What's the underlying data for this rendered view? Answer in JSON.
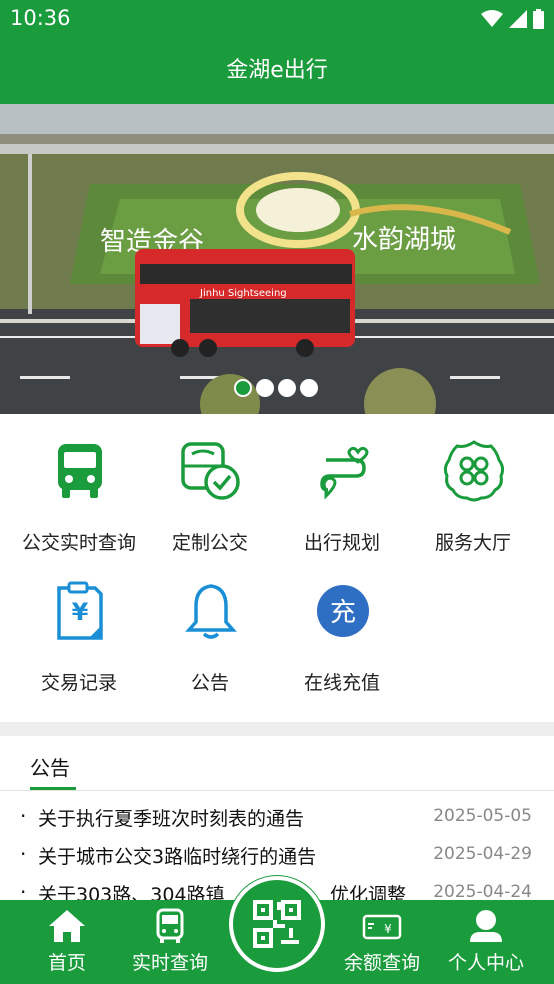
{
  "status_bar": {
    "time": "10:36"
  },
  "app_bar": {
    "title": "金湖e出行"
  },
  "banner": {
    "dots": 4,
    "active_dot": 0,
    "sign_text_left": "智造金谷",
    "sign_text_right": "水韵湖城",
    "bus_text": "Jinhu Sightseeing"
  },
  "services": [
    {
      "label": "公交实时查询",
      "icon": "bus-icon"
    },
    {
      "label": "定制公交",
      "icon": "custom-bus-icon"
    },
    {
      "label": "出行规划",
      "icon": "route-plan-icon"
    },
    {
      "label": "服务大厅",
      "icon": "service-hall-icon"
    },
    {
      "label": "交易记录",
      "icon": "transaction-record-icon"
    },
    {
      "label": "公告",
      "icon": "bell-icon"
    },
    {
      "label": "在线充值",
      "icon": "recharge-icon",
      "glyph": "充"
    }
  ],
  "notices": {
    "tab_label": "公告",
    "items": [
      {
        "title": "关于执行夏季班次时刻表的通告",
        "date": "2025-05-05"
      },
      {
        "title": "关于城市公交3路临时绕行的通告",
        "date": "2025-04-29"
      },
      {
        "title": "关于303路、304路镇",
        "date": "2025-04-24"
      }
    ],
    "partial_suffix": "优化调整"
  },
  "bottom_nav": {
    "home": "首页",
    "realtime": "实时查询",
    "balance": "余额查询",
    "profile": "个人中心"
  },
  "colors": {
    "brand": "#1a9b3c",
    "accent_blue": "#1a8fd6",
    "recharge_blue": "#2e6fc4"
  }
}
